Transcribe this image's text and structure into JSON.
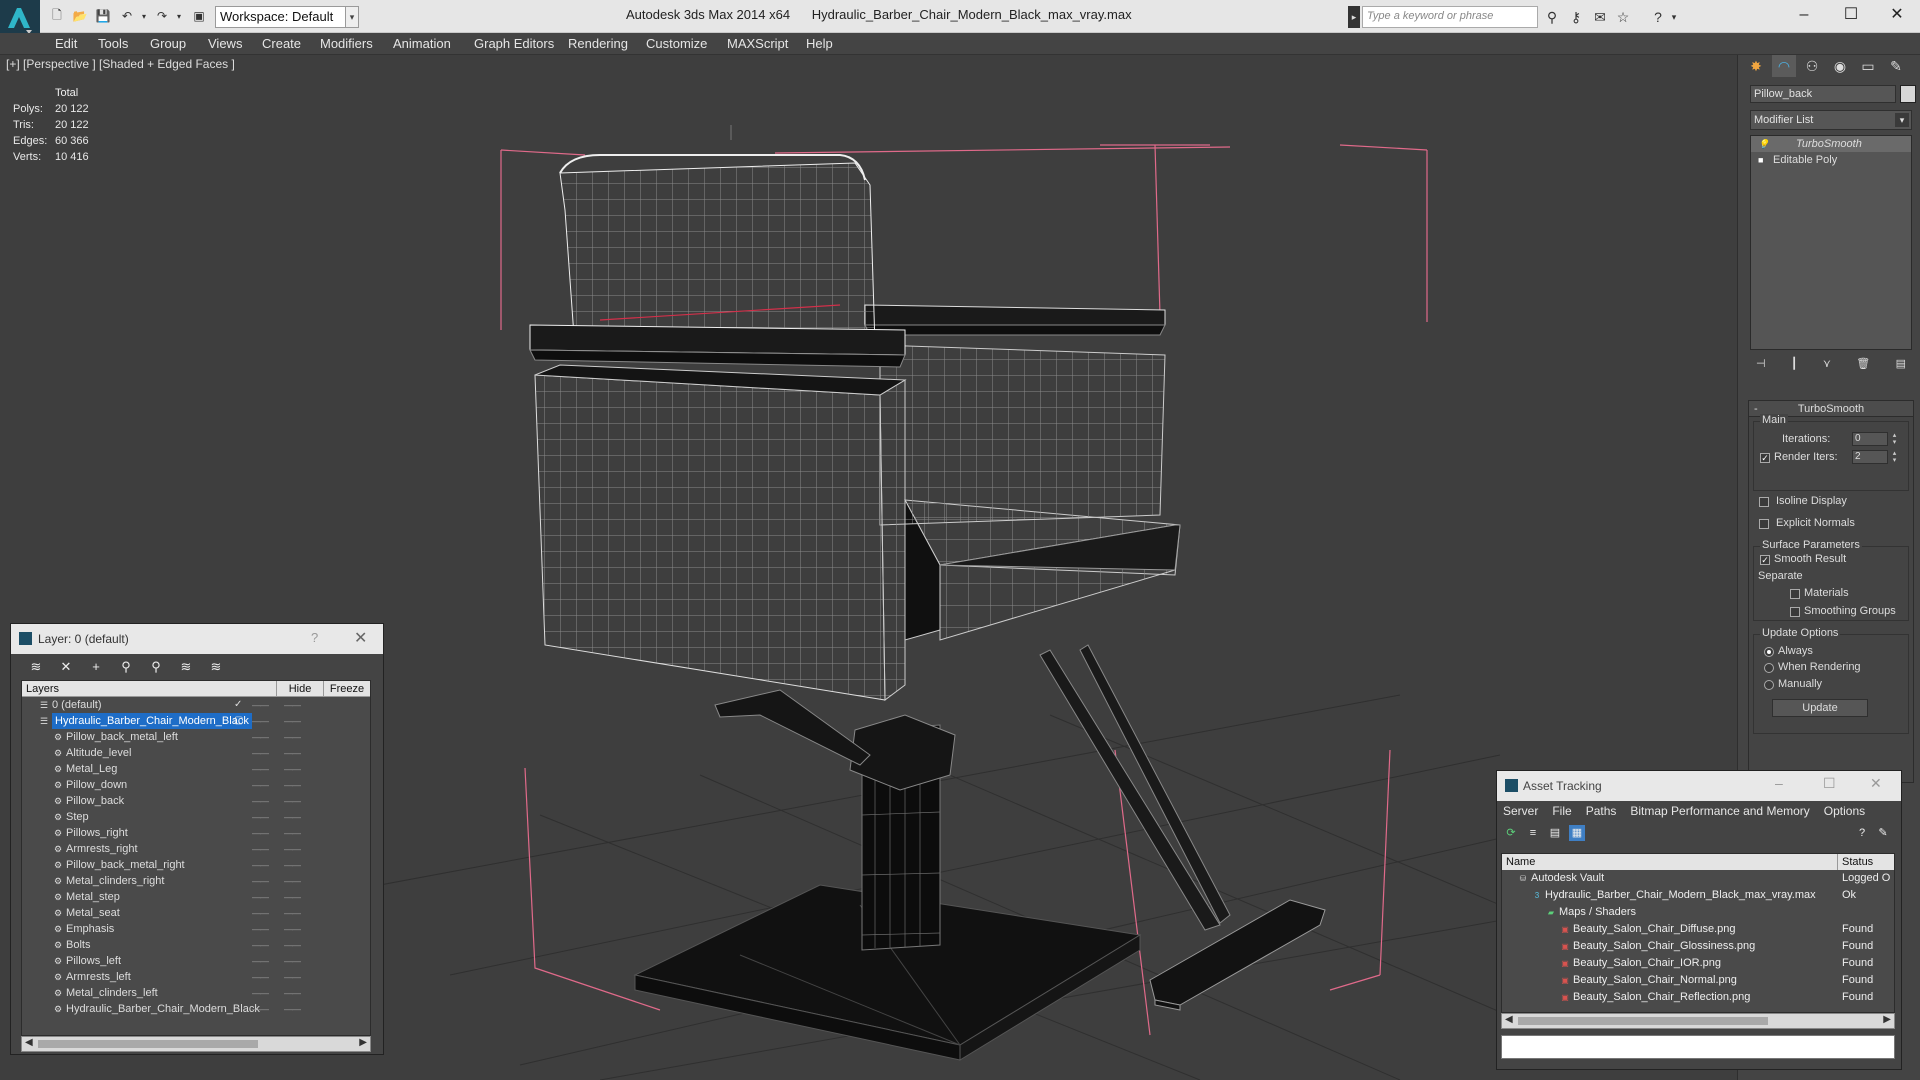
{
  "app": {
    "title": "Autodesk 3ds Max 2014 x64",
    "file": "Hydraulic_Barber_Chair_Modern_Black_max_vray.max",
    "workspace": "Workspace: Default",
    "search_placeholder": "Type a keyword or phrase"
  },
  "menu": [
    "Edit",
    "Tools",
    "Group",
    "Views",
    "Create",
    "Modifiers",
    "Animation",
    "Graph Editors",
    "Rendering",
    "Customize",
    "MAXScript",
    "Help"
  ],
  "viewport": {
    "label": "[+] [Perspective ] [Shaded + Edged Faces ]",
    "stats_header": "Total",
    "stats": [
      {
        "k": "Polys:",
        "v": "20 122"
      },
      {
        "k": "Tris:",
        "v": "20 122"
      },
      {
        "k": "Edges:",
        "v": "60 366"
      },
      {
        "k": "Verts:",
        "v": "10 416"
      }
    ]
  },
  "command_panel": {
    "object_name": "Pillow_back",
    "modifier_list": "Modifier List",
    "stack": [
      "TurboSmooth",
      "Editable Poly"
    ],
    "rollout_title": "TurboSmooth",
    "main_label": "Main",
    "iterations_label": "Iterations:",
    "iterations": "0",
    "render_iters_label": "Render Iters:",
    "render_iters": "2",
    "isoline": "Isoline Display",
    "explicit": "Explicit Normals",
    "surface_params": "Surface Parameters",
    "smooth_result": "Smooth Result",
    "separate": "Separate",
    "materials": "Materials",
    "smoothing_groups": "Smoothing Groups",
    "update_options": "Update Options",
    "always": "Always",
    "when_rendering": "When Rendering",
    "manually": "Manually",
    "update": "Update"
  },
  "layer_window": {
    "title": "Layer: 0 (default)",
    "help": "?",
    "col_layers": "Layers",
    "col_hide": "Hide",
    "col_freeze": "Freeze",
    "layers": [
      {
        "name": "0 (default)",
        "indent": 0
      },
      {
        "name": "Hydraulic_Barber_Chair_Modern_Black",
        "indent": 0
      },
      {
        "name": "Pillow_back_metal_left",
        "indent": 1
      },
      {
        "name": "Altitude_level",
        "indent": 1
      },
      {
        "name": "Metal_Leg",
        "indent": 1
      },
      {
        "name": "Pillow_down",
        "indent": 1
      },
      {
        "name": "Pillow_back",
        "indent": 1
      },
      {
        "name": "Step",
        "indent": 1
      },
      {
        "name": "Pillows_right",
        "indent": 1
      },
      {
        "name": "Armrests_right",
        "indent": 1
      },
      {
        "name": "Pillow_back_metal_right",
        "indent": 1
      },
      {
        "name": "Metal_clinders_right",
        "indent": 1
      },
      {
        "name": "Metal_step",
        "indent": 1
      },
      {
        "name": "Metal_seat",
        "indent": 1
      },
      {
        "name": "Emphasis",
        "indent": 1
      },
      {
        "name": "Bolts",
        "indent": 1
      },
      {
        "name": "Pillows_left",
        "indent": 1
      },
      {
        "name": "Armrests_left",
        "indent": 1
      },
      {
        "name": "Metal_clinders_left",
        "indent": 1
      },
      {
        "name": "Hydraulic_Barber_Chair_Modern_Black",
        "indent": 1
      }
    ]
  },
  "asset_window": {
    "title": "Asset Tracking",
    "menu": [
      "Server",
      "File",
      "Paths",
      "Bitmap Performance and Memory",
      "Options"
    ],
    "col_name": "Name",
    "col_status": "Status",
    "rows": [
      {
        "name": "Autodesk Vault",
        "status": "Logged O",
        "level": 0
      },
      {
        "name": "Hydraulic_Barber_Chair_Modern_Black_max_vray.max",
        "status": "Ok",
        "level": 1
      },
      {
        "name": "Maps / Shaders",
        "status": "",
        "level": 2
      },
      {
        "name": "Beauty_Salon_Chair_Diffuse.png",
        "status": "Found",
        "level": 3
      },
      {
        "name": "Beauty_Salon_Chair_Glossiness.png",
        "status": "Found",
        "level": 3
      },
      {
        "name": "Beauty_Salon_Chair_IOR.png",
        "status": "Found",
        "level": 3
      },
      {
        "name": "Beauty_Salon_Chair_Normal.png",
        "status": "Found",
        "level": 3
      },
      {
        "name": "Beauty_Salon_Chair_Reflection.png",
        "status": "Found",
        "level": 3
      }
    ]
  }
}
